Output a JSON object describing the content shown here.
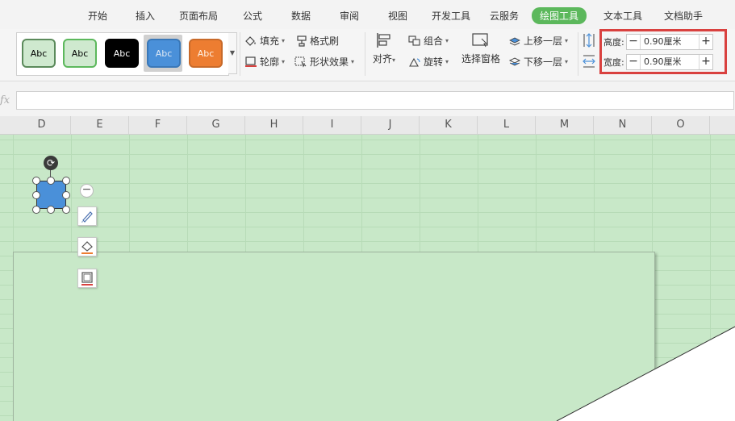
{
  "menu": {
    "items": [
      "开始",
      "插入",
      "页面布局",
      "公式",
      "数据",
      "审阅",
      "视图",
      "开发工具",
      "云服务",
      "绘图工具",
      "文本工具",
      "文档助手"
    ],
    "active_index": 9
  },
  "ribbon": {
    "style_gallery": {
      "swatches": [
        {
          "label": "Abc",
          "fill": "#cfe9cf",
          "border": "#5b8a5b",
          "text": "#000000"
        },
        {
          "label": "Abc",
          "fill": "#cfe9cf",
          "border": "#5cb85c",
          "text": "#000000"
        },
        {
          "label": "Abc",
          "fill": "#000000",
          "border": "#000000",
          "text": "#ffffff"
        },
        {
          "label": "Abc",
          "fill": "#4a90d9",
          "border": "#3a78b8",
          "text": "#dfe9f5"
        },
        {
          "label": "Abc",
          "fill": "#ed7d31",
          "border": "#c86a2a",
          "text": "#fff2e6"
        }
      ],
      "selected_index": 3,
      "more_icon": "triangle-down-icon"
    },
    "fill_label": "填充",
    "outline_label": "轮廓",
    "format_painter_label": "格式刷",
    "shape_effects_label": "形状效果",
    "align_label": "对齐",
    "group_label": "组合",
    "rotate_label": "旋转",
    "selection_pane_label": "选择窗格",
    "bring_forward_label": "上移一层",
    "send_backward_label": "下移一层",
    "height": {
      "label": "高度:",
      "value": "0.90厘米"
    },
    "width": {
      "label": "宽度:",
      "value": "0.90厘米"
    },
    "minus": "−",
    "plus": "+"
  },
  "formula_bar": {
    "fx": "fx",
    "value": ""
  },
  "columns": [
    "D",
    "E",
    "F",
    "G",
    "H",
    "I",
    "J",
    "K",
    "L",
    "M",
    "N",
    "O"
  ],
  "colors": {
    "accent_green": "#5cb85c",
    "highlight_red": "#d9413f",
    "sheet_green": "#c8e8c8",
    "shape_blue": "#4a90d9"
  }
}
